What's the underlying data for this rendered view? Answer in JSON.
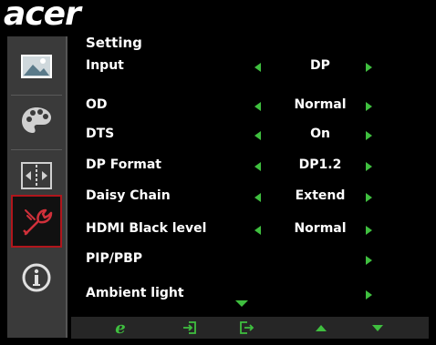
{
  "brand": "acer",
  "menu": {
    "title": "Setting",
    "rows": [
      {
        "label": "Input",
        "value": "DP",
        "left_arrow": true,
        "right_arrow": true
      },
      {
        "label": "OD",
        "value": "Normal",
        "left_arrow": true,
        "right_arrow": true
      },
      {
        "label": "DTS",
        "value": "On",
        "left_arrow": true,
        "right_arrow": true
      },
      {
        "label": "DP Format",
        "value": "DP1.2",
        "left_arrow": true,
        "right_arrow": true
      },
      {
        "label": "Daisy Chain",
        "value": "Extend",
        "left_arrow": true,
        "right_arrow": true
      },
      {
        "label": "HDMI Black level",
        "value": "Normal",
        "left_arrow": true,
        "right_arrow": true
      },
      {
        "label": "PIP/PBP",
        "value": "",
        "left_arrow": false,
        "right_arrow": true
      },
      {
        "label": "Ambient light",
        "value": "",
        "left_arrow": false,
        "right_arrow": true
      }
    ]
  },
  "sidebar": {
    "items": [
      {
        "icon": "picture-icon",
        "active": false
      },
      {
        "icon": "palette-icon",
        "active": false
      },
      {
        "icon": "screen-adjust-icon",
        "active": false
      },
      {
        "icon": "wrench-settings-icon",
        "active": true
      },
      {
        "icon": "info-icon",
        "active": false
      }
    ]
  },
  "bottom_bar": {
    "buttons": [
      "e-key-icon",
      "enter-icon",
      "exit-icon",
      "up-arrow-icon",
      "down-arrow-icon"
    ]
  },
  "colors": {
    "accent_green": "#3fbf3f",
    "active_red": "#b0161c",
    "sidebar_bg": "#3a3a3a"
  }
}
